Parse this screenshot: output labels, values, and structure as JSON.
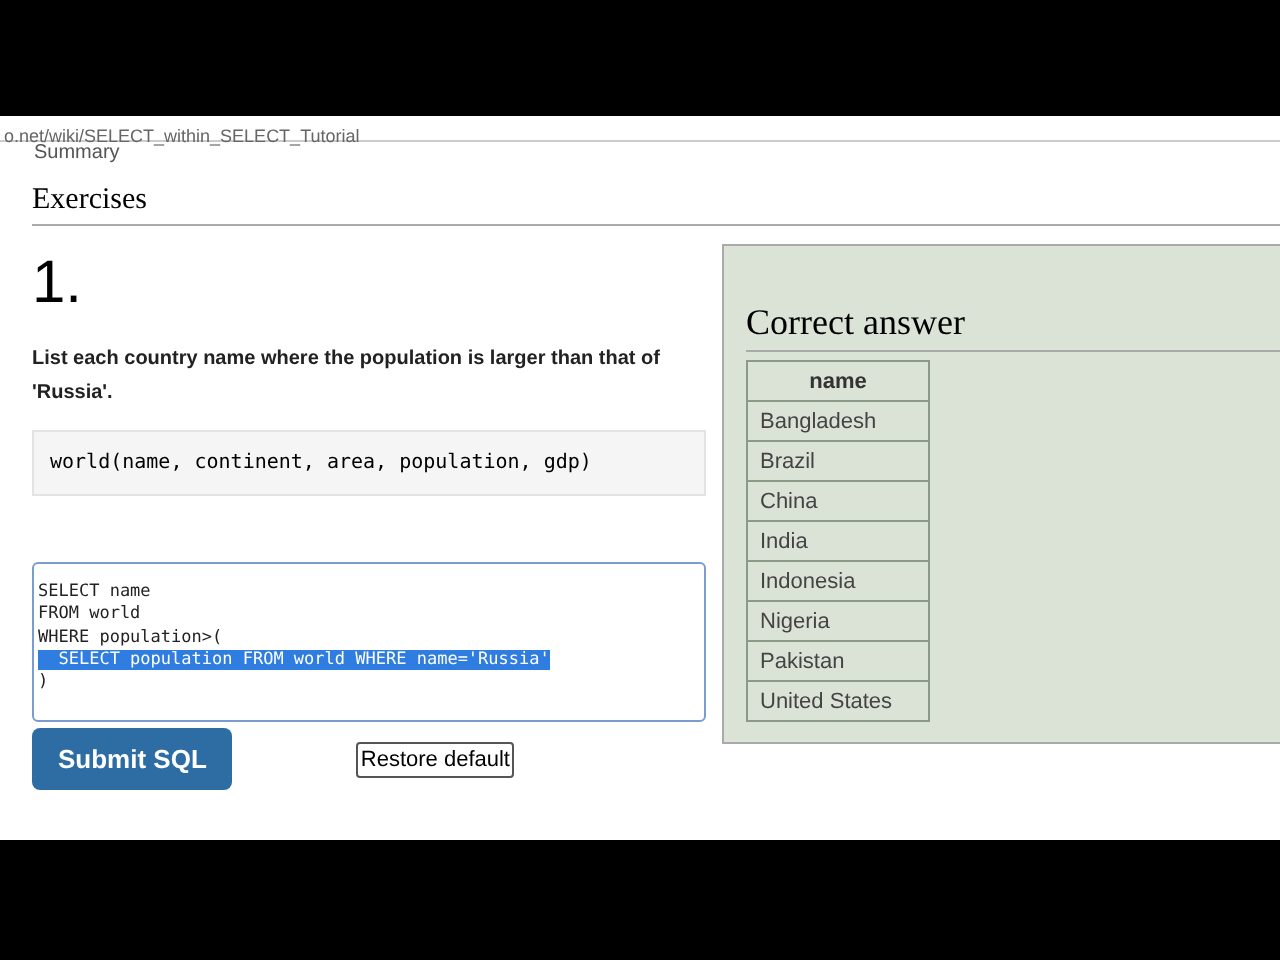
{
  "url": "o.net/wiki/SELECT_within_SELECT_Tutorial",
  "toc_item": "Summary",
  "section_title": "Exercises",
  "exercise": {
    "number": "1.",
    "question": "List each country name where the population is larger than that of 'Russia'.",
    "schema": "world(name, continent, area, population, gdp)",
    "code_lines": [
      {
        "text": "SELECT name",
        "selected": false
      },
      {
        "text": "FROM world",
        "selected": false
      },
      {
        "text": "WHERE population>(",
        "selected": false
      },
      {
        "text": "  SELECT population FROM world WHERE name='Russia'",
        "selected": true
      },
      {
        "text": ")",
        "selected": false
      }
    ],
    "buttons": [
      {
        "kind": "primary",
        "label": "Submit SQL"
      },
      {
        "kind": "plain",
        "label": "Restore default"
      }
    ]
  },
  "answer": {
    "title": "Correct answer",
    "columns": [
      "name"
    ],
    "rows": [
      "Bangladesh",
      "Brazil",
      "China",
      "India",
      "Indonesia",
      "Nigeria",
      "Pakistan",
      "United States"
    ]
  }
}
